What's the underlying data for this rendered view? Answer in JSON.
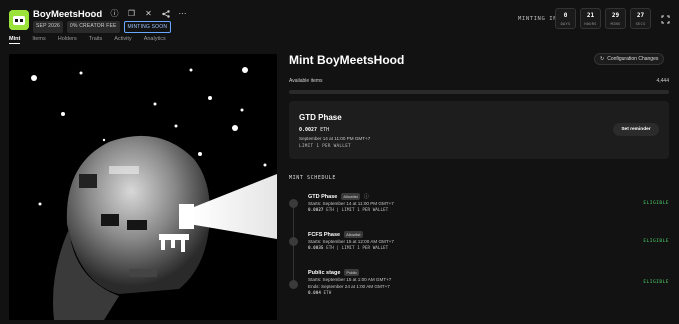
{
  "header": {
    "title": "BoyMeetsHood",
    "badges": [
      "SEP 2026",
      "0% CREATOR FEE",
      "MINTING SOON"
    ],
    "minting_label": "MINTING IN",
    "countdown": [
      {
        "value": "0",
        "unit": "DAYS"
      },
      {
        "value": "21",
        "unit": "HOURS"
      },
      {
        "value": "29",
        "unit": "MINS"
      },
      {
        "value": "27",
        "unit": "SECS"
      }
    ],
    "icons": [
      "star-icon",
      "info-icon",
      "copy-icon",
      "x-icon",
      "share-icon",
      "more-icon",
      "expand-icon"
    ]
  },
  "tabs": [
    "Mint",
    "Items",
    "Holders",
    "Traits",
    "Activity",
    "Analytics"
  ],
  "active_tab": "Mint",
  "main": {
    "title": "Mint BoyMeetsHood",
    "config_button": "Configuration Changes",
    "available_label": "Available items",
    "available_value": "4,444",
    "minted_fraction": 0.0
  },
  "phase_card": {
    "title": "GTD Phase",
    "price_value": "0.0027",
    "price_unit": "ETH",
    "date": "September 14 at 11:00 PM GMT+7",
    "limit": "LIMIT 1 PER WALLET",
    "button": "Set reminder"
  },
  "schedule": {
    "label": "MINT SCHEDULE",
    "stages": [
      {
        "name": "GTD Phase",
        "tag": "Allowlist",
        "lines": [
          "Starts: September 14 at 11:00 PM GMT+7"
        ],
        "price_value": "0.0027",
        "price_rest": "ETH | LIMIT 1 PER WALLET",
        "status": "ELIGIBLE"
      },
      {
        "name": "FCFS Phase",
        "tag": "Allowlist",
        "lines": [
          "Starts: September 15 at 12:00 AM GMT+7"
        ],
        "price_value": "0.0035",
        "price_rest": "ETH | LIMIT 1 PER WALLET",
        "status": "ELIGIBLE"
      },
      {
        "name": "Public stage",
        "tag": "Public",
        "lines": [
          "Starts: September 15 at 1:00 AM GMT+7",
          "Ends: September 24 at 1:00 AM GMT+7"
        ],
        "price_value": "0.004",
        "price_rest": "ETH",
        "status": "ELIGIBLE"
      }
    ]
  },
  "colors": {
    "background": "#121212",
    "card": "#1d1d1d",
    "eligible": "#4fd06b",
    "logo": "#9be33a"
  }
}
